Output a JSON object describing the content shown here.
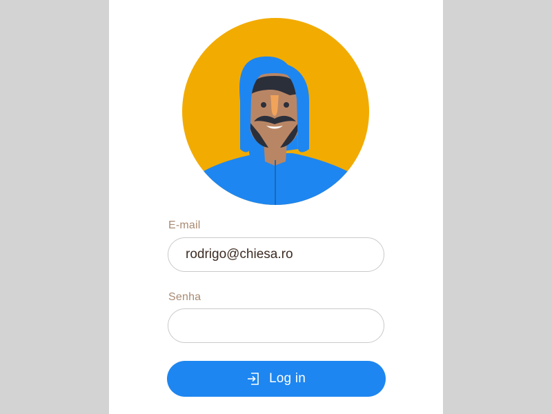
{
  "form": {
    "email_label": "E-mail",
    "email_value": "rodrigo@chiesa.ro",
    "password_label": "Senha",
    "password_value": "",
    "login_label": "Log in"
  },
  "avatar": {
    "icon": "avatar-hooded-man",
    "background_color": "#f2ab00",
    "hood_color": "#1e86f0"
  },
  "colors": {
    "page_background": "#d3d3d3",
    "card_background": "#ffffff",
    "label_color": "#a88a72",
    "button_color": "#1e86f0",
    "input_border": "#c9c9c9"
  },
  "icons": {
    "login_icon": "login-icon"
  }
}
